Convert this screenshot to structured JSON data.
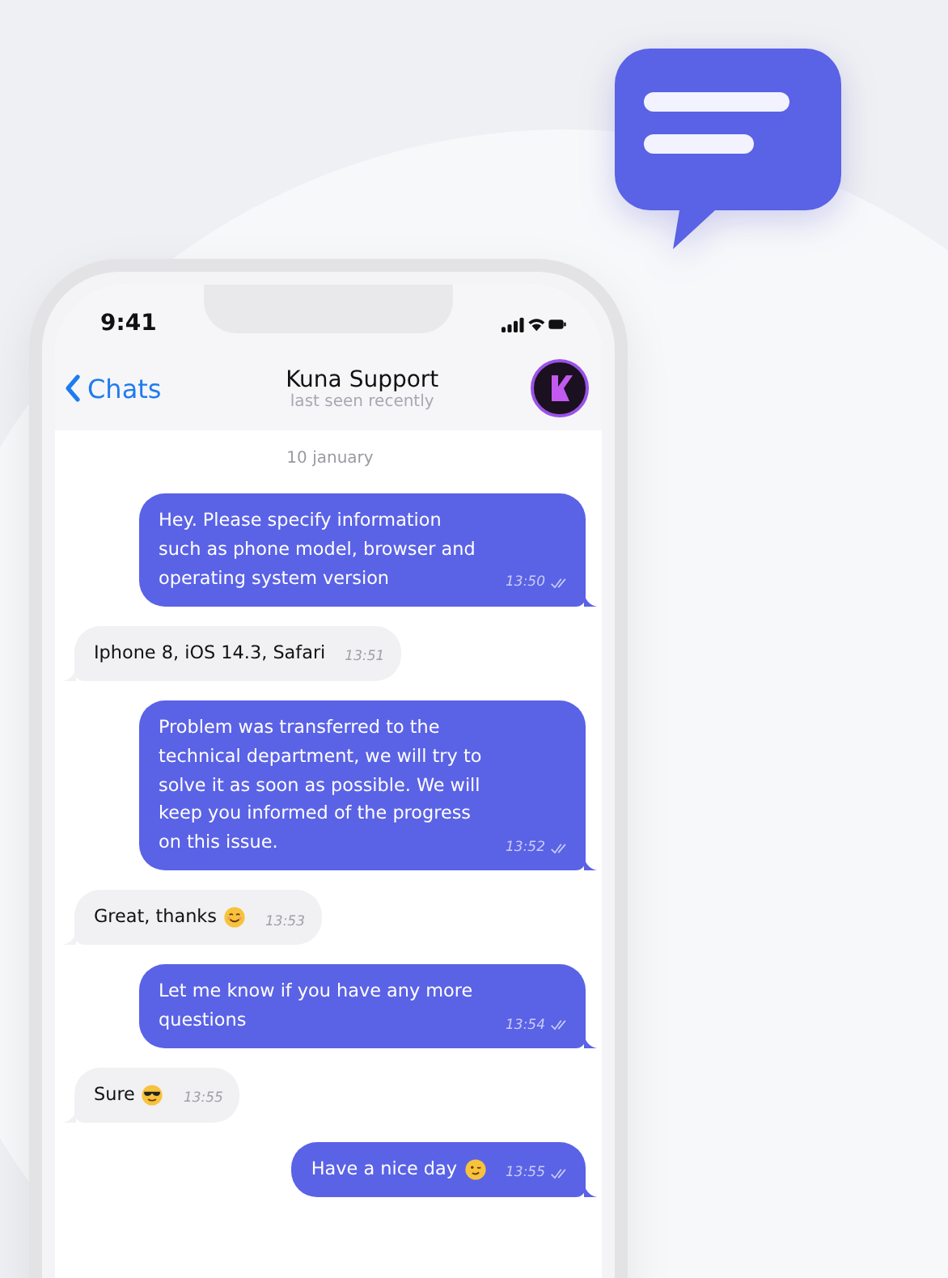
{
  "status_bar": {
    "time": "9:41"
  },
  "header": {
    "back_label": "Chats",
    "title": "Kuna Support",
    "subtitle": "last seen recently"
  },
  "date_label": "10 january",
  "messages": [
    {
      "kind": "outgoing",
      "text": "Hey. Please specify information such as phone model, browser and operating system version",
      "time": "13:50",
      "read": true
    },
    {
      "kind": "incoming",
      "text": "Iphone 8, iOS 14.3, Safari",
      "time": "13:51"
    },
    {
      "kind": "outgoing",
      "text": "Problem was transferred to the technical department, we will try to solve it as soon as possible. We will keep you informed of the progress on this issue.",
      "time": "13:52",
      "read": true
    },
    {
      "kind": "incoming",
      "text": "Great, thanks",
      "emoji": {
        "kind": "smile"
      },
      "time": "13:53"
    },
    {
      "kind": "outgoing",
      "text": "Let me know if you have any more questions",
      "time": "13:54",
      "read": true
    },
    {
      "kind": "incoming",
      "text": "Sure",
      "emoji": {
        "kind": "sunglasses"
      },
      "time": "13:55"
    },
    {
      "kind": "outgoing",
      "text": "Have a nice day",
      "emoji": {
        "kind": "wink"
      },
      "time": "13:55",
      "read": true
    }
  ]
}
